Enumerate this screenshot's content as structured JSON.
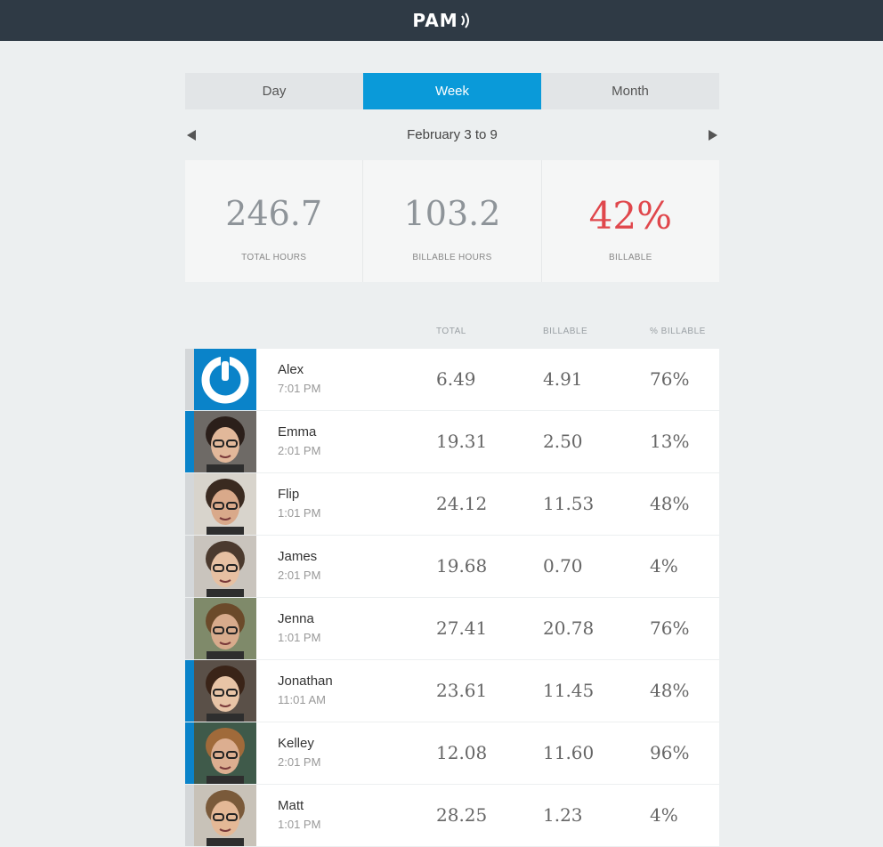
{
  "header": {
    "logo": "PAM"
  },
  "tabs": [
    {
      "label": "Day",
      "active": false
    },
    {
      "label": "Week",
      "active": true
    },
    {
      "label": "Month",
      "active": false
    }
  ],
  "date_range": "February 3 to 9",
  "stats": [
    {
      "value": "246.7",
      "label": "TOTAL HOURS"
    },
    {
      "value": "103.2",
      "label": "BILLABLE HOURS"
    },
    {
      "value": "42%",
      "label": "BILLABLE",
      "color": "#e0474c"
    }
  ],
  "table": {
    "columns": [
      "TOTAL",
      "BILLABLE",
      "% BILLABLE"
    ],
    "rows": [
      {
        "name": "Alex",
        "time": "7:01 PM",
        "total": "6.49",
        "billable": "4.91",
        "pct": "76%",
        "bar": "gray",
        "avatar": "logo"
      },
      {
        "name": "Emma",
        "time": "2:01 PM",
        "total": "19.31",
        "billable": "2.50",
        "pct": "13%",
        "bar": "blue",
        "avatar": "photo"
      },
      {
        "name": "Flip",
        "time": "1:01 PM",
        "total": "24.12",
        "billable": "11.53",
        "pct": "48%",
        "bar": "gray",
        "avatar": "photo"
      },
      {
        "name": "James",
        "time": "2:01 PM",
        "total": "19.68",
        "billable": "0.70",
        "pct": "4%",
        "bar": "gray",
        "avatar": "photo"
      },
      {
        "name": "Jenna",
        "time": "1:01 PM",
        "total": "27.41",
        "billable": "20.78",
        "pct": "76%",
        "bar": "gray",
        "avatar": "photo"
      },
      {
        "name": "Jonathan",
        "time": "11:01 AM",
        "total": "23.61",
        "billable": "11.45",
        "pct": "48%",
        "bar": "blue",
        "avatar": "photo"
      },
      {
        "name": "Kelley",
        "time": "2:01 PM",
        "total": "12.08",
        "billable": "11.60",
        "pct": "96%",
        "bar": "blue",
        "avatar": "photo"
      },
      {
        "name": "Matt",
        "time": "1:01 PM",
        "total": "28.25",
        "billable": "1.23",
        "pct": "4%",
        "bar": "gray",
        "avatar": "photo"
      }
    ]
  },
  "colors": {
    "accent": "#0a9ad9",
    "header_bg": "#2f3a45",
    "alert": "#e0474c"
  }
}
